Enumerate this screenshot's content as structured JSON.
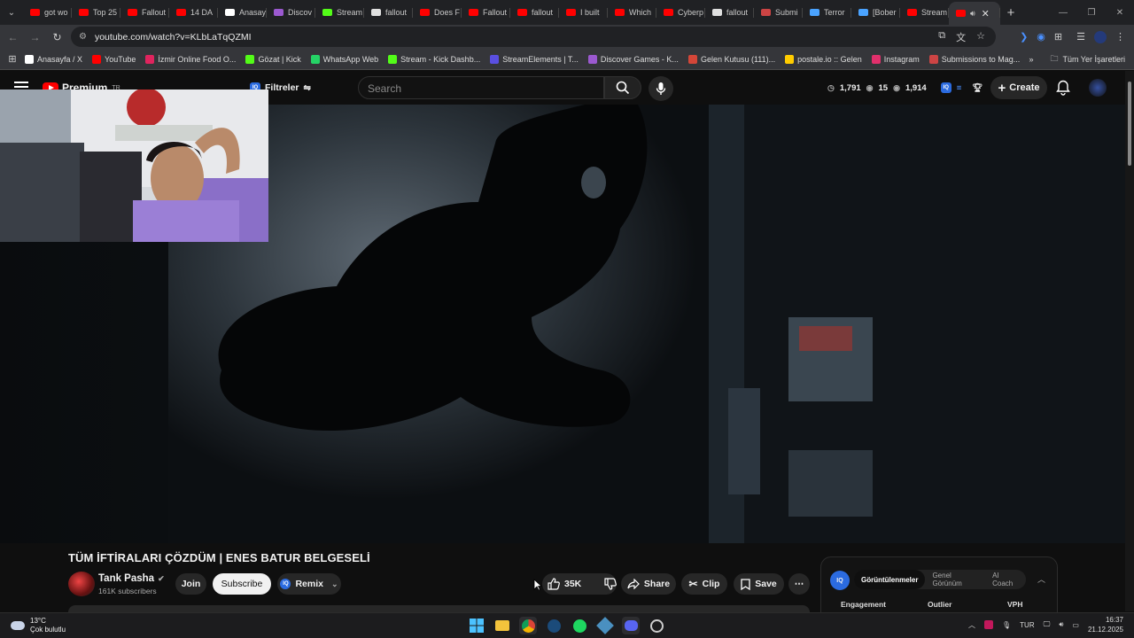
{
  "browser": {
    "tabs": [
      {
        "label": "got wo",
        "color": "#ff0000"
      },
      {
        "label": "Top 25",
        "color": "#ff0000"
      },
      {
        "label": "Fallout",
        "color": "#ff0000"
      },
      {
        "label": "14 DA",
        "color": "#ff0000"
      },
      {
        "label": "Anasay",
        "color": "#ffffff"
      },
      {
        "label": "Discov",
        "color": "#9b59d0"
      },
      {
        "label": "Stream",
        "color": "#53fc18"
      },
      {
        "label": "fallout",
        "color": "#e0e0e0"
      },
      {
        "label": "Does F",
        "color": "#ff0000"
      },
      {
        "label": "Fallout",
        "color": "#ff0000"
      },
      {
        "label": "fallout",
        "color": "#ff0000"
      },
      {
        "label": "I built",
        "color": "#ff0000"
      },
      {
        "label": "Which",
        "color": "#ff0000"
      },
      {
        "label": "Cyberp",
        "color": "#ff0000"
      },
      {
        "label": "fallout",
        "color": "#e0e0e0"
      },
      {
        "label": "Submi",
        "color": "#c44"
      },
      {
        "label": "Terror",
        "color": "#4aa3ff"
      },
      {
        "label": "[Bober",
        "color": "#4aa3ff"
      },
      {
        "label": "Stream",
        "color": "#ff0000"
      }
    ],
    "active_tab_close": "✕",
    "new_tab": "+",
    "url": "youtube.com/watch?v=KLbLaTqQZMI"
  },
  "bookmarks": [
    {
      "label": "Anasayfa / X",
      "color": "#ffffff"
    },
    {
      "label": "YouTube",
      "color": "#ff0000"
    },
    {
      "label": "İzmir Online Food O...",
      "color": "#e0245e"
    },
    {
      "label": "Gözat | Kick",
      "color": "#53fc18"
    },
    {
      "label": "WhatsApp Web",
      "color": "#25d366"
    },
    {
      "label": "Stream - Kick Dashb...",
      "color": "#53fc18"
    },
    {
      "label": "StreamElements | T...",
      "color": "#5a4fe0"
    },
    {
      "label": "Discover Games - K...",
      "color": "#9b59d0"
    },
    {
      "label": "Gelen Kutusu (111)...",
      "color": "#d44638"
    },
    {
      "label": "postale.io :: Gelen",
      "color": "#ffcc00"
    },
    {
      "label": "Instagram",
      "color": "#e1306c"
    },
    {
      "label": "Submissions to Mag...",
      "color": "#c44"
    }
  ],
  "bookmarks_all": "Tüm Yer İşaretleri",
  "youtube": {
    "logo_text": "Premium",
    "logo_region": "TR",
    "filter_label": "Filtreler",
    "search_placeholder": "Search",
    "stats": {
      "a": "1,791",
      "b": "15",
      "c": "1,914"
    },
    "create_label": "Create",
    "iq_badge": "IQ"
  },
  "video": {
    "title": "TÜM İFTİRALARI ÇÖZDÜM | ENES BATUR BELGESELİ",
    "channel_name": "Tank Pasha",
    "subscribers": "161K subscribers",
    "join": "Join",
    "subscribe": "Subscribe",
    "remix": "Remix",
    "likes": "35K",
    "share": "Share",
    "clip": "Clip",
    "save": "Save",
    "more": "⋯"
  },
  "panel": {
    "badge": "IQ",
    "tabs": [
      "Görüntülenmeler",
      "Genel Görünüm",
      "AI Coach"
    ],
    "columns": [
      "Engagement",
      "Outlier",
      "VPH"
    ]
  },
  "taskbar": {
    "temp": "13°C",
    "weather": "Çok bulutlu",
    "lang": "TUR",
    "time": "16:37",
    "date": "21.12.2025"
  }
}
